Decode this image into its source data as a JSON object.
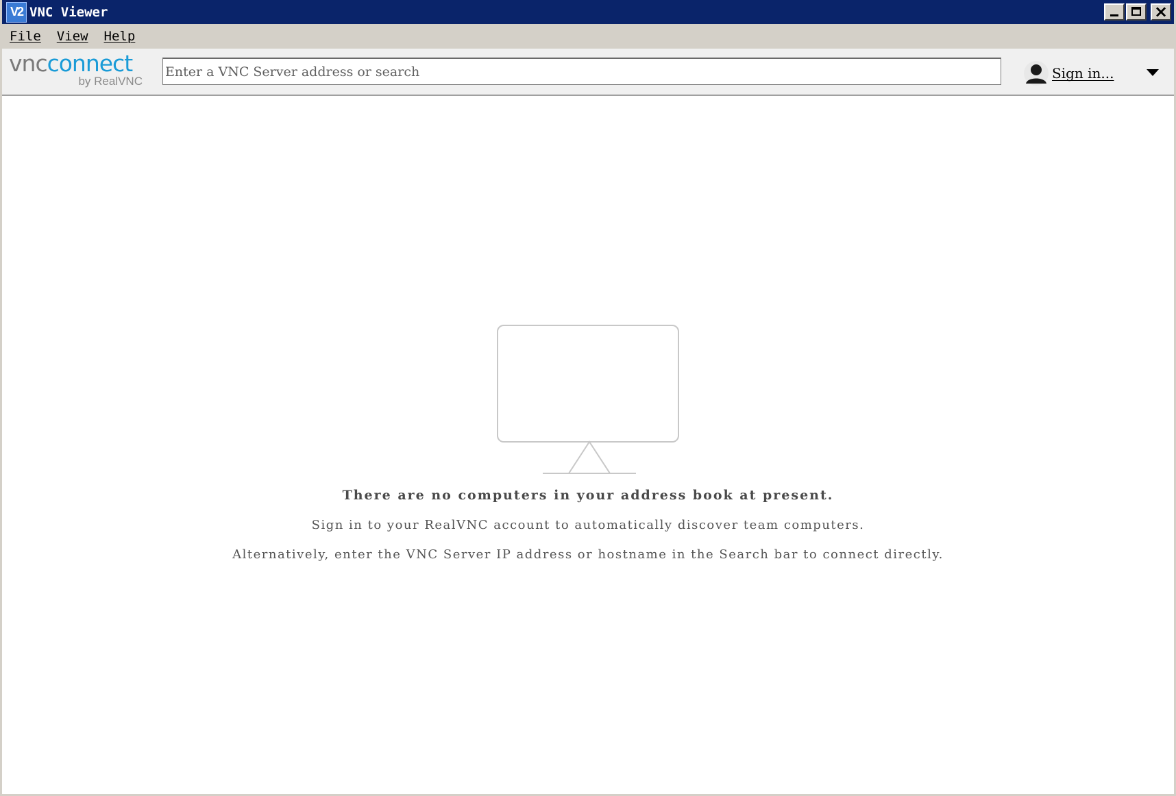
{
  "window": {
    "title": "VNC Viewer",
    "icon_text": "V2",
    "controls": [
      "minimize",
      "maximize",
      "close"
    ]
  },
  "menu": {
    "items": [
      {
        "label": "File"
      },
      {
        "label": "View"
      },
      {
        "label": "Help"
      }
    ]
  },
  "toolbar": {
    "logo": {
      "vnc": "vnc",
      "connect": "connect",
      "byline": "by RealVNC"
    },
    "search": {
      "placeholder": "Enter a VNC Server address or search",
      "value": ""
    },
    "account": {
      "label": "Sign in...",
      "icon": "user-icon"
    }
  },
  "empty_state": {
    "icon": "monitor-icon",
    "title": "There are no computers in your address book at present.",
    "line1": "Sign in to your RealVNC account to automatically discover team computers.",
    "line2": "Alternatively, enter the VNC Server IP address or hostname in the Search bar to connect directly."
  },
  "colors": {
    "titlebar": "#0a246a",
    "chrome": "#d4d0c8",
    "accent": "#1a9bd7"
  }
}
